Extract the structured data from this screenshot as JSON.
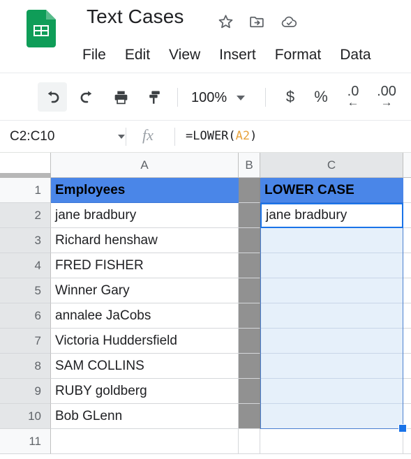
{
  "app": {
    "logo_icon": "sheets-logo-icon",
    "doc_title": "Text Cases",
    "title_icons": [
      {
        "name": "star-icon",
        "label": "Star"
      },
      {
        "name": "move-to-folder-icon",
        "label": "Move"
      },
      {
        "name": "cloud-saved-icon",
        "label": "Saved to Drive"
      }
    ]
  },
  "menubar": {
    "items": [
      {
        "label": "File"
      },
      {
        "label": "Edit"
      },
      {
        "label": "View"
      },
      {
        "label": "Insert"
      },
      {
        "label": "Format"
      },
      {
        "label": "Data"
      }
    ]
  },
  "toolbar": {
    "undo_label": "Undo",
    "redo_label": "Redo",
    "print_label": "Print",
    "paint_format_label": "Paint format",
    "zoom_value": "100%",
    "currency_label": "$",
    "percent_label": "%",
    "decrease_decimal_label": ".0",
    "decrease_decimal_arrow": "←",
    "increase_decimal_label": ".00",
    "increase_decimal_arrow": "→"
  },
  "formula_bar": {
    "name_box_value": "C2:C10",
    "fx_label": "fx",
    "formula_prefix": "=LOWER(",
    "formula_ref": "A2",
    "formula_suffix": ")"
  },
  "grid": {
    "column_headers": [
      {
        "label": "A",
        "state": "normal"
      },
      {
        "label": "B",
        "state": "normal"
      },
      {
        "label": "C",
        "state": "selected"
      },
      {
        "label": "",
        "state": "normal"
      }
    ],
    "row_headers": [
      {
        "label": "1",
        "state": "normal"
      },
      {
        "label": "2",
        "state": "selected"
      },
      {
        "label": "3",
        "state": "selected"
      },
      {
        "label": "4",
        "state": "selected"
      },
      {
        "label": "5",
        "state": "selected"
      },
      {
        "label": "6",
        "state": "selected"
      },
      {
        "label": "7",
        "state": "selected"
      },
      {
        "label": "8",
        "state": "selected"
      },
      {
        "label": "9",
        "state": "selected"
      },
      {
        "label": "10",
        "state": "selected"
      },
      {
        "label": "11",
        "state": "normal"
      }
    ],
    "rows": [
      {
        "a": "Employees",
        "b": "",
        "c": "LOWER CASE"
      },
      {
        "a": "jane bradbury",
        "b": "",
        "c": "jane bradbury"
      },
      {
        "a": "Richard henshaw",
        "b": "",
        "c": ""
      },
      {
        "a": "FRED FISHER",
        "b": "",
        "c": ""
      },
      {
        "a": "Winner Gary",
        "b": "",
        "c": ""
      },
      {
        "a": "annalee JaCobs",
        "b": "",
        "c": ""
      },
      {
        "a": "Victoria Huddersfield",
        "b": "",
        "c": ""
      },
      {
        "a": "SAM COLLINS",
        "b": "",
        "c": ""
      },
      {
        "a": "RUBY goldberg",
        "b": "",
        "c": ""
      },
      {
        "a": "Bob GLenn",
        "b": "",
        "c": ""
      },
      {
        "a": "",
        "b": "",
        "c": ""
      }
    ],
    "active_cell_value": "jane bradbury",
    "selection_range": "C2:C10"
  },
  "colors": {
    "brand_green": "#0f9d58",
    "header_blue": "#4a86e8",
    "selection_blue": "#e6f0fa",
    "active_border": "#1a73e8",
    "fill_gray": "#919191",
    "formula_ref": "#e8a33d"
  }
}
